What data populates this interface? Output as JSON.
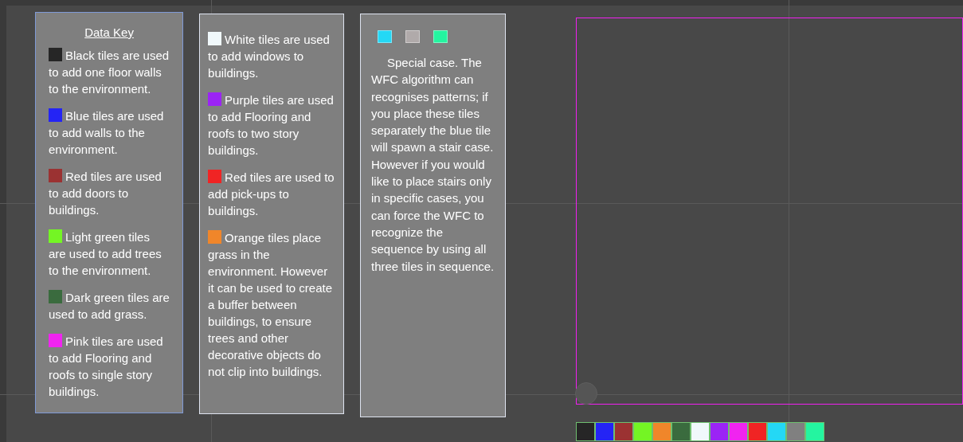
{
  "key_panels": [
    {
      "title": "Data Key",
      "entries": [
        {
          "color": "#262626",
          "text": "Black tiles are used to add one floor walls to the environment."
        },
        {
          "color": "#2424f5",
          "text": "Blue tiles are used to add walls to the environment."
        },
        {
          "color": "#9b3232",
          "text": "Red tiles are used to add doors to buildings."
        },
        {
          "color": "#74f524",
          "text": "Light green tiles are used to add trees to the environment."
        },
        {
          "color": "#3a6b3e",
          "text": "Dark green tiles are used to add grass."
        },
        {
          "color": "#f024f0",
          "text": "Pink tiles are used to add Flooring and roofs to single story buildings."
        }
      ]
    },
    {
      "entries": [
        {
          "color": "#f0f8fb",
          "text": "White tiles are used to add windows to buildings."
        },
        {
          "color": "#9b24f5",
          "text": "Purple tiles are used to add Flooring and roofs to two story buildings."
        },
        {
          "color": "#f02424",
          "text": "Red tiles are used to add pick-ups to buildings."
        },
        {
          "color": "#f0862a",
          "text": "Orange tiles place grass in the environment. However it can be used to create a buffer between buildings, to ensure trees and other decorative objects do not clip into buildings."
        }
      ]
    }
  ],
  "special_panel": {
    "swatches": [
      {
        "color": "#24d8f5"
      },
      {
        "color": "#b0aaaa"
      },
      {
        "color": "#24f5a0"
      }
    ],
    "text": "Special case. The WFC algorithm can recognises patterns; if you place these tiles separately the blue tile will spawn a stair case. However if you would like to place stairs only in specific cases, you can force the WFC to recognize the sequence by using all three tiles in sequence."
  },
  "palette": [
    {
      "color": "#262626"
    },
    {
      "color": "#2424f5"
    },
    {
      "color": "#9b3232"
    },
    {
      "color": "#74f524"
    },
    {
      "color": "#f0862a"
    },
    {
      "color": "#3a6b3e"
    },
    {
      "color": "#f0f8fb"
    },
    {
      "color": "#9b24f5"
    },
    {
      "color": "#f024f0"
    },
    {
      "color": "#f02424"
    },
    {
      "color": "#24d8f5"
    },
    {
      "color": "#808080"
    },
    {
      "color": "#24f5a0"
    }
  ]
}
